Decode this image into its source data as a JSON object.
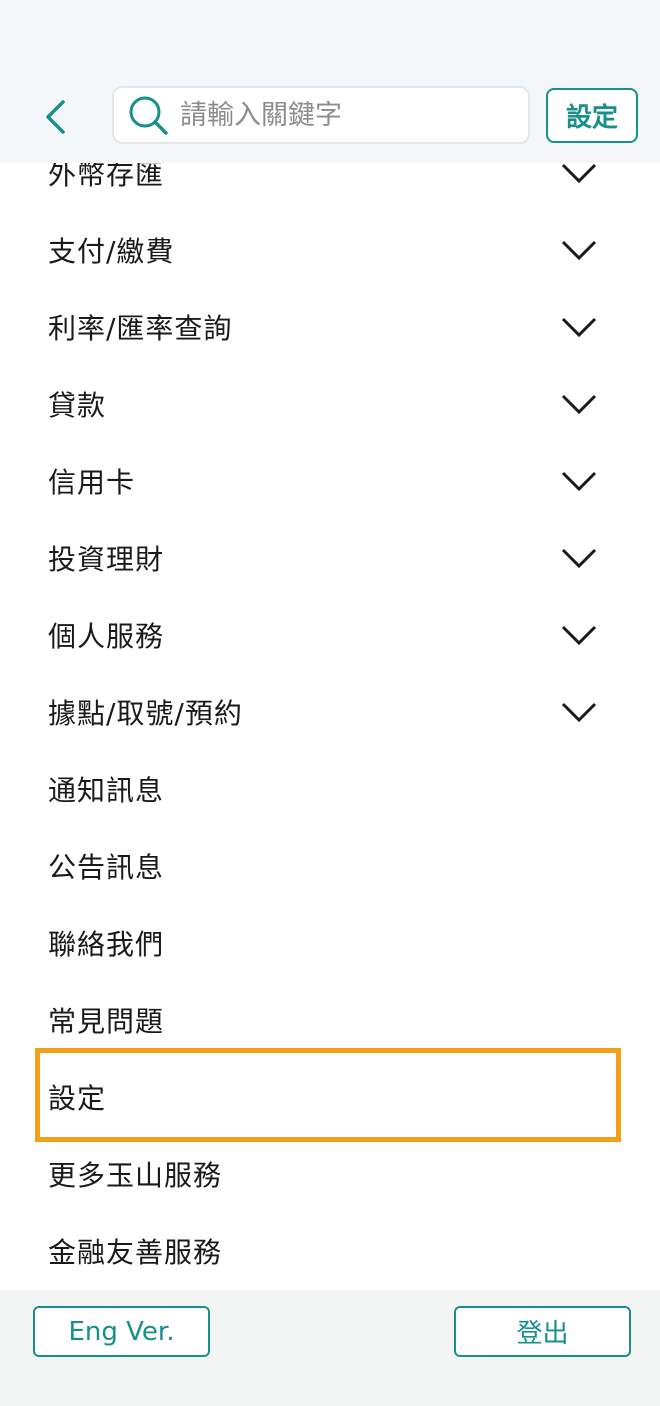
{
  "header": {
    "search_placeholder": "請輸入關鍵字",
    "settings_label": "設定"
  },
  "menu": {
    "items": [
      {
        "label": "外幣存匯",
        "has_submenu": true
      },
      {
        "label": "支付/繳費",
        "has_submenu": true
      },
      {
        "label": "利率/匯率查詢",
        "has_submenu": true
      },
      {
        "label": "貸款",
        "has_submenu": true
      },
      {
        "label": "信用卡",
        "has_submenu": true
      },
      {
        "label": "投資理財",
        "has_submenu": true
      },
      {
        "label": "個人服務",
        "has_submenu": true
      },
      {
        "label": "據點/取號/預約",
        "has_submenu": true
      },
      {
        "label": "通知訊息",
        "has_submenu": false
      },
      {
        "label": "公告訊息",
        "has_submenu": false
      },
      {
        "label": "聯絡我們",
        "has_submenu": false
      },
      {
        "label": "常見問題",
        "has_submenu": false
      },
      {
        "label": "設定",
        "has_submenu": false,
        "highlighted": true
      },
      {
        "label": "更多玉山服務",
        "has_submenu": false
      },
      {
        "label": "金融友善服務",
        "has_submenu": false
      }
    ]
  },
  "footer": {
    "eng_label": "Eng Ver.",
    "logout_label": "登出"
  },
  "icons": {
    "back": "chevron-left-icon",
    "search": "search-icon",
    "expand": "chevron-down-icon"
  },
  "colors": {
    "accent": "#17908a",
    "highlight": "#f0a01a",
    "header_bg": "#f4f7f9",
    "footer_bg": "#f3f4f4"
  }
}
